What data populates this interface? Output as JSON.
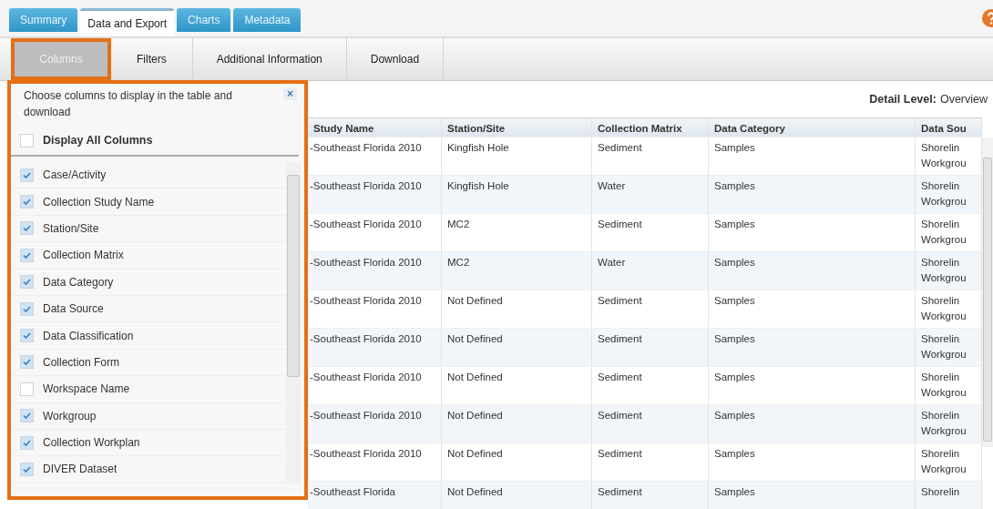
{
  "tabs": [
    {
      "label": "Summary",
      "selected": false
    },
    {
      "label": "Data and Export",
      "selected": true
    },
    {
      "label": "Charts",
      "selected": false
    },
    {
      "label": "Metadata",
      "selected": false
    }
  ],
  "subtabs": [
    {
      "label": "Columns",
      "selected": true
    },
    {
      "label": "Filters",
      "selected": false
    },
    {
      "label": "Additional Information",
      "selected": false
    },
    {
      "label": "Download",
      "selected": false
    }
  ],
  "column_chooser": {
    "instructions": "Choose columns to display in the table and download",
    "close": "×",
    "display_all": {
      "label": "Display All Columns",
      "checked": false
    },
    "items": [
      {
        "label": "Case/Activity",
        "checked": true
      },
      {
        "label": "Collection Study Name",
        "checked": true
      },
      {
        "label": "Station/Site",
        "checked": true
      },
      {
        "label": "Collection Matrix",
        "checked": true
      },
      {
        "label": "Data Category",
        "checked": true
      },
      {
        "label": "Data Source",
        "checked": true
      },
      {
        "label": "Data Classification",
        "checked": true
      },
      {
        "label": "Collection Form",
        "checked": true
      },
      {
        "label": "Workspace Name",
        "checked": false
      },
      {
        "label": "Workgroup",
        "checked": true
      },
      {
        "label": "Collection Workplan",
        "checked": true
      },
      {
        "label": "DIVER Dataset",
        "checked": true
      }
    ]
  },
  "detail_level": {
    "label": "Detail Level:",
    "value": "Overview"
  },
  "table": {
    "columns": [
      "Study Name",
      "Station/Site",
      "Collection Matrix",
      "Data Category",
      "Data Sou"
    ],
    "rows": [
      [
        "-Southeast Florida 2010",
        "Kingfish Hole",
        "Sediment",
        "Samples",
        "Shorelin Workgrou"
      ],
      [
        "-Southeast Florida 2010",
        "Kingfish Hole",
        "Water",
        "Samples",
        "Shorelin Workgrou"
      ],
      [
        "-Southeast Florida 2010",
        "MC2",
        "Sediment",
        "Samples",
        "Shorelin Workgrou"
      ],
      [
        "-Southeast Florida 2010",
        "MC2",
        "Water",
        "Samples",
        "Shorelin Workgrou"
      ],
      [
        "-Southeast Florida 2010",
        "Not Defined",
        "Sediment",
        "Samples",
        "Shorelin Workgrou"
      ],
      [
        "-Southeast Florida 2010",
        "Not Defined",
        "Sediment",
        "Samples",
        "Shorelin Workgrou"
      ],
      [
        "-Southeast Florida 2010",
        "Not Defined",
        "Sediment",
        "Samples",
        "Shorelin Workgrou"
      ],
      [
        "-Southeast Florida 2010",
        "Not Defined",
        "Sediment",
        "Samples",
        "Shorelin Workgrou"
      ],
      [
        "-Southeast Florida 2010",
        "Not Defined",
        "Sediment",
        "Samples",
        "Shorelin Workgrou"
      ],
      [
        "-Southeast Florida",
        "Not Defined",
        "Sediment",
        "Samples",
        "Shorelin"
      ]
    ]
  }
}
